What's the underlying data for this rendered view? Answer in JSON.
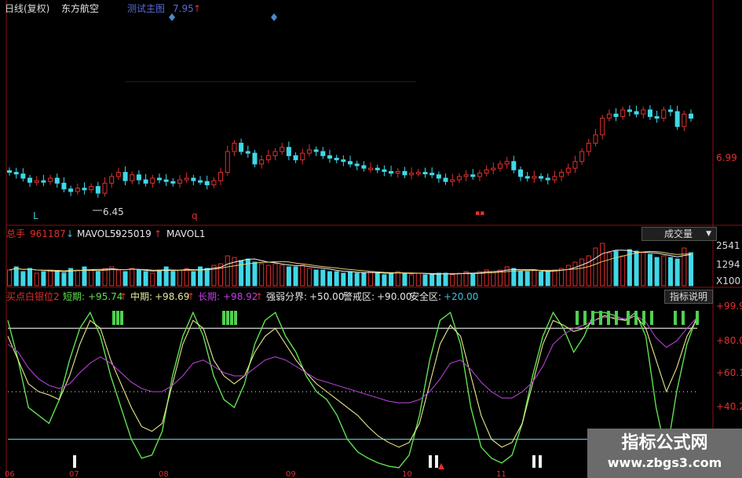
{
  "header": {
    "period": "日线(复权)",
    "stock": "东方航空",
    "test_label": "测试主图",
    "test_value": "7.95",
    "test_arrow": "↑"
  },
  "price_panel": {
    "right_tick": "6.99",
    "low_label": "6.45",
    "mark_l": "L",
    "mark_q": "q",
    "mark_box": "▪▪"
  },
  "volume_panel": {
    "total_label": "总手",
    "total_value": "961187",
    "total_arrow": "↓",
    "mavol5_label": "MAVOL5:",
    "mavol5_value": "925019",
    "mavol5_arrow": "↑",
    "mavol1_label": "MAVOL1",
    "button": "成交量",
    "ticks": [
      "2541",
      "1294",
      "X100"
    ]
  },
  "indicator_panel": {
    "name": "买点白银位2",
    "short_label": "短期:",
    "short_value": "+95.74",
    "mid_label": "中期:",
    "mid_value": "+98.69",
    "long_label": "长期:",
    "long_value": "+98.92",
    "strong_label": "强弱分界:",
    "strong_value": "+50.00",
    "warn_label": "警戒区:",
    "warn_value": "+90.00",
    "safe_label": "安全区:",
    "safe_value": "+20.00",
    "up_arrow": "↑",
    "button": "指标说明",
    "ticks": [
      "+99.9",
      "+80.0",
      "+60.1",
      "+40.2"
    ]
  },
  "date_ticks": [
    "06",
    "07",
    "08",
    "09",
    "10",
    "11"
  ],
  "watermark": {
    "line1": "指标公式网",
    "line2": "www.zbgs3.com"
  },
  "colors": {
    "up": "#e03030",
    "down": "#40d8e8",
    "short": "#60e050",
    "mid": "#e8e890",
    "long": "#b040d0"
  },
  "chart_data": [
    {
      "type": "candlestick",
      "title": "东方航空 日线(复权)",
      "ylim": [
        6.2,
        8.2
      ],
      "y_ticks": [
        6.99
      ],
      "annotations": [
        "6.45",
        "L",
        "q"
      ],
      "values_close": [
        6.85,
        6.83,
        6.78,
        6.73,
        6.75,
        6.74,
        6.78,
        6.72,
        6.65,
        6.62,
        6.66,
        6.64,
        6.68,
        6.6,
        6.72,
        6.8,
        6.85,
        6.75,
        6.82,
        6.76,
        6.72,
        6.78,
        6.76,
        6.74,
        6.72,
        6.76,
        6.78,
        6.75,
        6.74,
        6.7,
        6.75,
        6.85,
        7.1,
        7.2,
        7.1,
        7.08,
        6.95,
        7.0,
        7.05,
        7.1,
        7.15,
        7.05,
        7.0,
        7.08,
        7.12,
        7.1,
        7.05,
        7.02,
        7.0,
        6.98,
        6.95,
        6.93,
        6.9,
        6.9,
        6.88,
        6.86,
        6.84,
        6.86,
        6.82,
        6.84,
        6.85,
        6.84,
        6.82,
        6.78,
        6.74,
        6.76,
        6.8,
        6.82,
        6.8,
        6.84,
        6.88,
        6.9,
        6.95,
        6.98,
        6.88,
        6.8,
        6.78,
        6.8,
        6.78,
        6.76,
        6.8,
        6.85,
        6.9,
        6.98,
        7.1,
        7.2,
        7.3,
        7.5,
        7.55,
        7.52,
        7.6,
        7.58,
        7.55,
        7.6,
        7.52,
        7.5,
        7.6,
        7.58,
        7.4,
        7.55,
        7.5
      ]
    },
    {
      "type": "bar",
      "title": "成交量",
      "y_ticks": [
        2541,
        1294
      ],
      "unit": "X100",
      "values": [
        10,
        12,
        9,
        11,
        8,
        9,
        10,
        9,
        8,
        11,
        10,
        12,
        10,
        9,
        11,
        12,
        10,
        9,
        11,
        10,
        9,
        8,
        10,
        12,
        9,
        10,
        11,
        9,
        12,
        11,
        13,
        14,
        19,
        18,
        16,
        17,
        15,
        14,
        13,
        14,
        13,
        12,
        12,
        13,
        11,
        10,
        10,
        9,
        9,
        8,
        9,
        8,
        8,
        9,
        8,
        7,
        8,
        9,
        8,
        7,
        8,
        7,
        7,
        8,
        8,
        7,
        8,
        9,
        8,
        9,
        10,
        9,
        10,
        12,
        11,
        9,
        9,
        10,
        9,
        9,
        10,
        11,
        13,
        15,
        17,
        19,
        24,
        27,
        21,
        22,
        19,
        23,
        22,
        21,
        20,
        18,
        19,
        18,
        17,
        24,
        21
      ]
    },
    {
      "type": "line",
      "title": "买点白银位2",
      "ylim": [
        0,
        105
      ],
      "y_ticks": [
        99.9,
        80.0,
        60.1,
        40.2
      ],
      "reference_lines": {
        "强弱分界": 50,
        "警戒区": 90,
        "安全区": 20
      },
      "series": [
        {
          "name": "短期",
          "values": [
            95,
            70,
            40,
            35,
            30,
            45,
            70,
            90,
            100,
            85,
            60,
            40,
            20,
            8,
            10,
            25,
            60,
            85,
            100,
            85,
            60,
            45,
            40,
            55,
            80,
            95,
            100,
            85,
            75,
            60,
            50,
            45,
            35,
            20,
            12,
            8,
            5,
            3,
            2,
            10,
            35,
            70,
            95,
            100,
            80,
            40,
            15,
            8,
            5,
            10,
            30,
            60,
            85,
            100,
            90,
            75,
            85,
            100,
            100,
            98,
            95,
            100,
            85,
            40,
            10,
            50,
            80,
            98
          ]
        },
        {
          "name": "中期",
          "values": [
            85,
            70,
            55,
            50,
            48,
            45,
            60,
            80,
            95,
            90,
            70,
            55,
            40,
            28,
            25,
            30,
            55,
            80,
            95,
            90,
            70,
            60,
            55,
            60,
            75,
            85,
            90,
            80,
            70,
            62,
            55,
            50,
            45,
            40,
            35,
            28,
            22,
            18,
            15,
            18,
            30,
            55,
            80,
            92,
            85,
            60,
            35,
            20,
            15,
            18,
            30,
            55,
            80,
            95,
            92,
            88,
            90,
            95,
            98,
            96,
            95,
            98,
            90,
            70,
            50,
            65,
            85,
            96
          ]
        },
        {
          "name": "长期",
          "values": [
            80,
            75,
            65,
            58,
            54,
            52,
            55,
            62,
            68,
            72,
            68,
            62,
            56,
            52,
            50,
            50,
            54,
            60,
            68,
            70,
            66,
            62,
            60,
            60,
            65,
            70,
            72,
            70,
            66,
            62,
            58,
            56,
            54,
            52,
            50,
            48,
            46,
            44,
            43,
            43,
            45,
            50,
            58,
            68,
            70,
            64,
            56,
            50,
            46,
            46,
            50,
            56,
            66,
            80,
            86,
            90,
            92,
            95,
            97,
            97,
            96,
            98,
            94,
            84,
            78,
            82,
            90,
            97
          ]
        }
      ]
    }
  ]
}
